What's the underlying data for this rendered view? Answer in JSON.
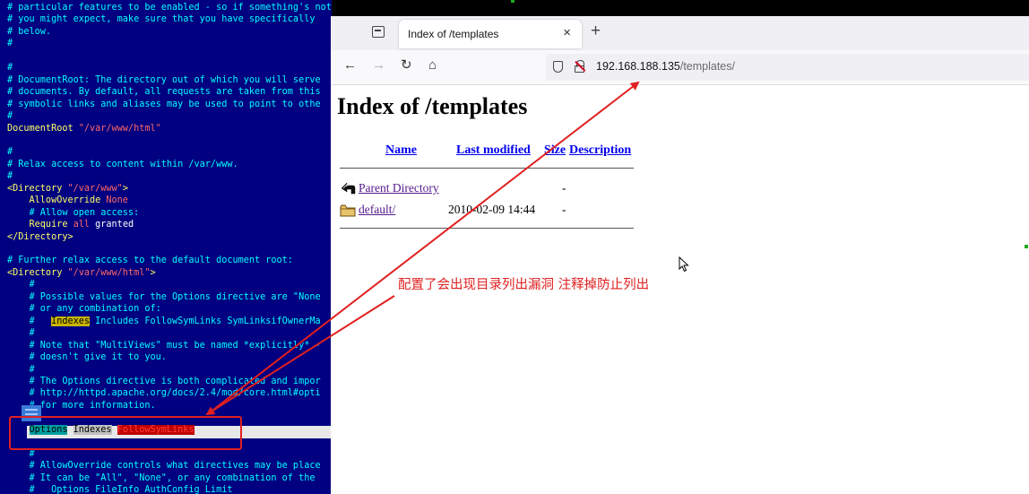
{
  "terminal": {
    "lines": [
      [
        {
          "t": "# particular features to be enabled - so if something's not working as",
          "c": "c-comment"
        }
      ],
      [
        {
          "t": "# you might expect, make sure that you have specifically",
          "c": "c-comment"
        }
      ],
      [
        {
          "t": "# below.",
          "c": "c-comment"
        }
      ],
      [
        {
          "t": "#",
          "c": "c-comment"
        }
      ],
      [
        {
          "t": "",
          "c": "c-comment"
        }
      ],
      [
        {
          "t": "#",
          "c": "c-comment"
        }
      ],
      [
        {
          "t": "# DocumentRoot: The directory out of which you will serve",
          "c": "c-comment"
        }
      ],
      [
        {
          "t": "# documents. By default, all requests are taken from this",
          "c": "c-comment"
        }
      ],
      [
        {
          "t": "# symbolic links and aliases may be used to point to othe",
          "c": "c-comment"
        }
      ],
      [
        {
          "t": "#",
          "c": "c-comment"
        }
      ],
      [
        {
          "t": "DocumentRoot ",
          "c": "c-key"
        },
        {
          "t": "\"/var/www/html\"",
          "c": "c-str"
        }
      ],
      [
        {
          "t": "",
          "c": "c-comment"
        }
      ],
      [
        {
          "t": "#",
          "c": "c-comment"
        }
      ],
      [
        {
          "t": "# Relax access to content within /var/www.",
          "c": "c-comment"
        }
      ],
      [
        {
          "t": "#",
          "c": "c-comment"
        }
      ],
      [
        {
          "t": "<Directory ",
          "c": "c-tag"
        },
        {
          "t": "\"/var/www\"",
          "c": "c-str"
        },
        {
          "t": ">",
          "c": "c-tag"
        }
      ],
      [
        {
          "t": "    AllowOverride ",
          "c": "c-key"
        },
        {
          "t": "None",
          "c": "c-str"
        }
      ],
      [
        {
          "t": "    # Allow open access:",
          "c": "c-comment"
        }
      ],
      [
        {
          "t": "    Require ",
          "c": "c-key"
        },
        {
          "t": "all",
          "c": "c-str"
        },
        {
          "t": " granted",
          "c": "c-white"
        }
      ],
      [
        {
          "t": "</Directory>",
          "c": "c-tag"
        }
      ],
      [
        {
          "t": "",
          "c": "c-comment"
        }
      ],
      [
        {
          "t": "# Further relax access to the default document root:",
          "c": "c-comment"
        }
      ],
      [
        {
          "t": "<Directory ",
          "c": "c-tag"
        },
        {
          "t": "\"/var/www/html\"",
          "c": "c-str"
        },
        {
          "t": ">",
          "c": "c-tag"
        }
      ],
      [
        {
          "t": "    #",
          "c": "c-comment"
        }
      ],
      [
        {
          "t": "    # Possible values for the Options directive are \"None",
          "c": "c-comment"
        }
      ],
      [
        {
          "t": "    # or any combination of:",
          "c": "c-comment"
        }
      ],
      [
        {
          "t": "    #   ",
          "c": "c-comment"
        },
        {
          "t": "Indexes",
          "c": "hl-yellow"
        },
        {
          "t": " Includes FollowSymLinks SymLinksifOwnerMa",
          "c": "c-comment"
        }
      ],
      [
        {
          "t": "    #",
          "c": "c-comment"
        }
      ],
      [
        {
          "t": "    # Note that \"MultiViews\" must be named *explicitly* -",
          "c": "c-comment"
        }
      ],
      [
        {
          "t": "    # doesn't give it to you.",
          "c": "c-comment"
        }
      ],
      [
        {
          "t": "    #",
          "c": "c-comment"
        }
      ],
      [
        {
          "t": "    # The Options directive is both complicated and impor",
          "c": "c-comment"
        }
      ],
      [
        {
          "t": "    # http://httpd.apache.org/docs/2.4/mod/core.html#opti",
          "c": "c-comment"
        }
      ],
      [
        {
          "t": "    # for more information.",
          "c": "c-comment"
        }
      ],
      [
        {
          "t": "",
          "c": "c-comment"
        }
      ],
      [
        {
          "t": "    ",
          "c": "c-comment"
        },
        {
          "t": "Options",
          "c": "hl-teal"
        },
        {
          "t": " ",
          "c": "c-comment"
        },
        {
          "t": "Indexes",
          "c": "hl-dim"
        },
        {
          "t": " ",
          "c": "c-comment"
        },
        {
          "t": "FollowSymLinks",
          "c": "hl-red"
        }
      ],
      [
        {
          "t": "",
          "c": "c-comment"
        }
      ],
      [
        {
          "t": "    #",
          "c": "c-comment"
        }
      ],
      [
        {
          "t": "    # AllowOverride controls what directives may be place",
          "c": "c-comment"
        }
      ],
      [
        {
          "t": "    # It can be \"All\", \"None\", or any combination of the",
          "c": "c-comment"
        }
      ],
      [
        {
          "t": "    #   Options FileInfo AuthConfig Limit",
          "c": "c-comment"
        }
      ]
    ]
  },
  "browser": {
    "tab_title": "Index of /templates",
    "tab_close": "×",
    "new_tab": "+",
    "nav": {
      "back": "←",
      "forward": "→",
      "reload": "↻",
      "home": "⌂"
    },
    "url_host": "192.168.188.135",
    "url_path": "/templates/",
    "page": {
      "heading": "Index of /templates",
      "columns": [
        "Name",
        "Last modified",
        "Size",
        "Description"
      ],
      "rows": [
        {
          "name": "Parent Directory",
          "modified": "",
          "size": "-",
          "icon": "back-arrow-icon"
        },
        {
          "name": "default/",
          "modified": "2010-02-09 14:44",
          "size": "-",
          "icon": "folder-icon"
        }
      ]
    },
    "annotation": "配置了会出现目录列出漏洞 注释掉防止列出"
  },
  "colors": {
    "terminal_bg": "#000080",
    "annotation_red": "#e02020",
    "link_blue": "#0000ee",
    "visited_purple": "#551a8b"
  }
}
